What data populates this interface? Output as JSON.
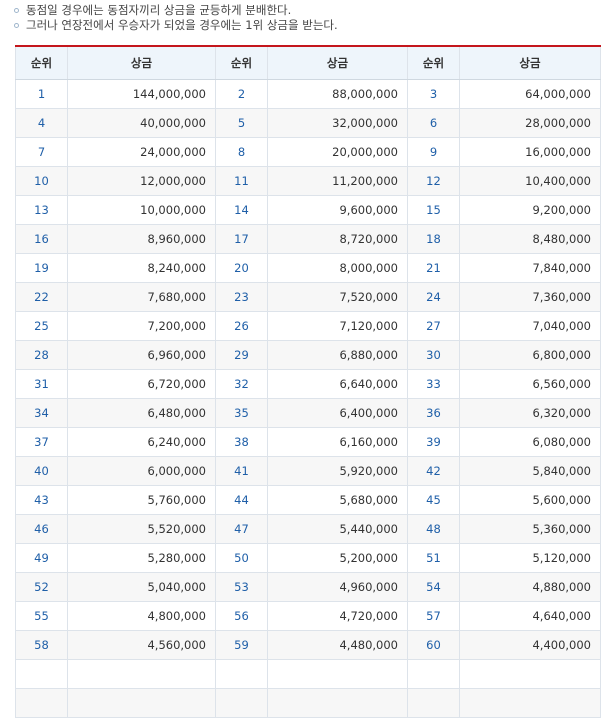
{
  "notes": [
    "동점일 경우에는 동점자끼리 상금을 균등하게 분배한다.",
    "그러나 연장전에서 우승자가 되었을 경우에는 1위 상금을 받는다."
  ],
  "headers": [
    "순위",
    "상금",
    "순위",
    "상금",
    "순위",
    "상금"
  ],
  "rows": [
    [
      {
        "rank": "1",
        "prize": "144,000,000"
      },
      {
        "rank": "2",
        "prize": "88,000,000"
      },
      {
        "rank": "3",
        "prize": "64,000,000"
      }
    ],
    [
      {
        "rank": "4",
        "prize": "40,000,000"
      },
      {
        "rank": "5",
        "prize": "32,000,000"
      },
      {
        "rank": "6",
        "prize": "28,000,000"
      }
    ],
    [
      {
        "rank": "7",
        "prize": "24,000,000"
      },
      {
        "rank": "8",
        "prize": "20,000,000"
      },
      {
        "rank": "9",
        "prize": "16,000,000"
      }
    ],
    [
      {
        "rank": "10",
        "prize": "12,000,000"
      },
      {
        "rank": "11",
        "prize": "11,200,000"
      },
      {
        "rank": "12",
        "prize": "10,400,000"
      }
    ],
    [
      {
        "rank": "13",
        "prize": "10,000,000"
      },
      {
        "rank": "14",
        "prize": "9,600,000"
      },
      {
        "rank": "15",
        "prize": "9,200,000"
      }
    ],
    [
      {
        "rank": "16",
        "prize": "8,960,000"
      },
      {
        "rank": "17",
        "prize": "8,720,000"
      },
      {
        "rank": "18",
        "prize": "8,480,000"
      }
    ],
    [
      {
        "rank": "19",
        "prize": "8,240,000"
      },
      {
        "rank": "20",
        "prize": "8,000,000"
      },
      {
        "rank": "21",
        "prize": "7,840,000"
      }
    ],
    [
      {
        "rank": "22",
        "prize": "7,680,000"
      },
      {
        "rank": "23",
        "prize": "7,520,000"
      },
      {
        "rank": "24",
        "prize": "7,360,000"
      }
    ],
    [
      {
        "rank": "25",
        "prize": "7,200,000"
      },
      {
        "rank": "26",
        "prize": "7,120,000"
      },
      {
        "rank": "27",
        "prize": "7,040,000"
      }
    ],
    [
      {
        "rank": "28",
        "prize": "6,960,000"
      },
      {
        "rank": "29",
        "prize": "6,880,000"
      },
      {
        "rank": "30",
        "prize": "6,800,000"
      }
    ],
    [
      {
        "rank": "31",
        "prize": "6,720,000"
      },
      {
        "rank": "32",
        "prize": "6,640,000"
      },
      {
        "rank": "33",
        "prize": "6,560,000"
      }
    ],
    [
      {
        "rank": "34",
        "prize": "6,480,000"
      },
      {
        "rank": "35",
        "prize": "6,400,000"
      },
      {
        "rank": "36",
        "prize": "6,320,000"
      }
    ],
    [
      {
        "rank": "37",
        "prize": "6,240,000"
      },
      {
        "rank": "38",
        "prize": "6,160,000"
      },
      {
        "rank": "39",
        "prize": "6,080,000"
      }
    ],
    [
      {
        "rank": "40",
        "prize": "6,000,000"
      },
      {
        "rank": "41",
        "prize": "5,920,000"
      },
      {
        "rank": "42",
        "prize": "5,840,000"
      }
    ],
    [
      {
        "rank": "43",
        "prize": "5,760,000"
      },
      {
        "rank": "44",
        "prize": "5,680,000"
      },
      {
        "rank": "45",
        "prize": "5,600,000"
      }
    ],
    [
      {
        "rank": "46",
        "prize": "5,520,000"
      },
      {
        "rank": "47",
        "prize": "5,440,000"
      },
      {
        "rank": "48",
        "prize": "5,360,000"
      }
    ],
    [
      {
        "rank": "49",
        "prize": "5,280,000"
      },
      {
        "rank": "50",
        "prize": "5,200,000"
      },
      {
        "rank": "51",
        "prize": "5,120,000"
      }
    ],
    [
      {
        "rank": "52",
        "prize": "5,040,000"
      },
      {
        "rank": "53",
        "prize": "4,960,000"
      },
      {
        "rank": "54",
        "prize": "4,880,000"
      }
    ],
    [
      {
        "rank": "55",
        "prize": "4,800,000"
      },
      {
        "rank": "56",
        "prize": "4,720,000"
      },
      {
        "rank": "57",
        "prize": "4,640,000"
      }
    ],
    [
      {
        "rank": "58",
        "prize": "4,560,000"
      },
      {
        "rank": "59",
        "prize": "4,480,000"
      },
      {
        "rank": "60",
        "prize": "4,400,000"
      }
    ],
    [
      {
        "rank": "",
        "prize": ""
      },
      {
        "rank": "",
        "prize": ""
      },
      {
        "rank": "",
        "prize": ""
      }
    ],
    [
      {
        "rank": "",
        "prize": ""
      },
      {
        "rank": "",
        "prize": ""
      },
      {
        "rank": "",
        "prize": ""
      }
    ]
  ]
}
